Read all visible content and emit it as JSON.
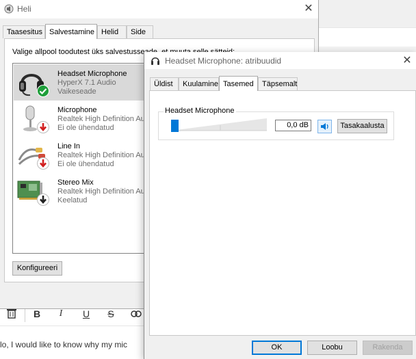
{
  "background": {
    "post_text": "lo, I would like to know why my mic",
    "toolbar": [
      "delete-icon",
      "bold-icon",
      "italic-icon",
      "underline-icon",
      "strikethrough-icon",
      "link-icon"
    ]
  },
  "heli": {
    "title": "Heli",
    "tabs": [
      {
        "label": "Taasesitus",
        "active": false
      },
      {
        "label": "Salvestamine",
        "active": true
      },
      {
        "label": "Helid",
        "active": false
      },
      {
        "label": "Side",
        "active": false
      }
    ],
    "instruction": "Valige allpool toodutest üks salvestusseade, et muuta selle sätteid:",
    "devices": [
      {
        "name": "Headset Microphone",
        "description": "HyperX 7.1 Audio",
        "status": "Vaikeseade",
        "icon": "headset-icon",
        "badge": "check-badge-icon",
        "selected": true
      },
      {
        "name": "Microphone",
        "description": "Realtek High Definition Audio",
        "status": "Ei ole ühendatud",
        "icon": "microphone-icon",
        "badge": "unplugged-badge-icon",
        "selected": false
      },
      {
        "name": "Line In",
        "description": "Realtek High Definition Audio",
        "status": "Ei ole ühendatud",
        "icon": "line-in-icon",
        "badge": "unplugged-badge-icon",
        "selected": false
      },
      {
        "name": "Stereo Mix",
        "description": "Realtek High Definition Audio",
        "status": "Keelatud",
        "icon": "sound-card-icon",
        "badge": "disabled-badge-icon",
        "selected": false
      }
    ],
    "configure_button": "Konfigureeri"
  },
  "attributes": {
    "title": "Headset Microphone: atribuudid",
    "tabs": [
      {
        "label": "Üldist",
        "active": false
      },
      {
        "label": "Kuulamine",
        "active": false
      },
      {
        "label": "Tasemed",
        "active": true
      },
      {
        "label": "Täpsemalt",
        "active": false
      }
    ],
    "level_group_label": "Headset Microphone",
    "level_value": "0,0 dB",
    "level_fraction": 0.0,
    "balance_button": "Tasakaalusta",
    "ok_button": "OK",
    "cancel_button": "Loobu",
    "apply_button": "Rakenda"
  },
  "colors": {
    "accent": "#0078d7",
    "check_badge": "#1e9e3a",
    "unplugged_badge": "#d11f1f",
    "disabled_badge": "#222222"
  }
}
